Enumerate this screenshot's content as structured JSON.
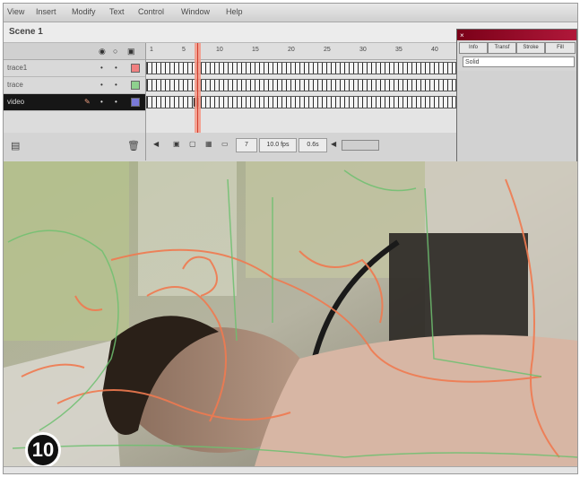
{
  "menubar": {
    "items": [
      "View",
      "Insert",
      "Modify",
      "Text",
      "Control",
      "Window",
      "Help"
    ]
  },
  "scene": {
    "name": "Scene 1"
  },
  "timeline": {
    "layers": [
      {
        "name": "trace1",
        "swatch": "#f08080"
      },
      {
        "name": "trace",
        "swatch": "#8ed08e"
      },
      {
        "name": "video",
        "swatch": "#7a7ad8"
      }
    ],
    "ruler": [
      "1",
      "5",
      "10",
      "15",
      "20",
      "25",
      "30",
      "35",
      "40"
    ],
    "footer": {
      "current_frame": "7",
      "frame_rate": "10.0 fps",
      "elapsed": "0.6s"
    }
  },
  "panel": {
    "tabs": [
      "Info",
      "Transf",
      "Stroke",
      "Fill"
    ],
    "field_value": "Solid"
  },
  "badge": {
    "number": "10"
  }
}
